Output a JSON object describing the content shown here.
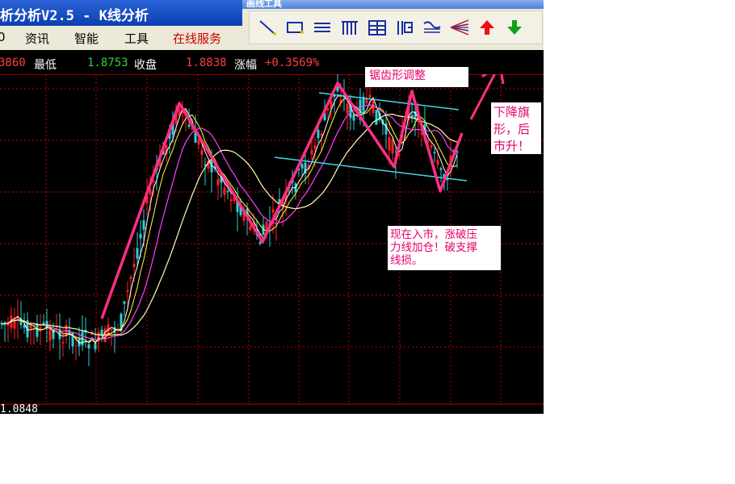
{
  "window": {
    "title": "析分析V2.5 - K线分析"
  },
  "menu": {
    "items": [
      {
        "label": "0",
        "color": "#000000"
      },
      {
        "label": "资讯",
        "color": "#000000"
      },
      {
        "label": "智能",
        "color": "#000000"
      },
      {
        "label": "工具",
        "color": "#000000"
      },
      {
        "label": "在线服务",
        "color": "#cc0000"
      }
    ]
  },
  "draw_toolbar": {
    "title": "画线工具",
    "tools": [
      {
        "icon": "diagonal-line-icon"
      },
      {
        "icon": "rectangle-icon"
      },
      {
        "icon": "parallel-lines-icon"
      },
      {
        "icon": "gann-bars-icon"
      },
      {
        "icon": "fibonacci-box-icon"
      },
      {
        "icon": "cycle-lines-icon"
      },
      {
        "icon": "percent-lines-icon"
      },
      {
        "icon": "fan-lines-icon"
      },
      {
        "icon": "up-arrow-icon"
      },
      {
        "icon": "down-arrow-icon"
      }
    ]
  },
  "quote": {
    "prefix_value": "3860",
    "low_label": "最低",
    "low_value": "1.8753",
    "close_label": "收盘",
    "close_value": "1.8838",
    "change_label": "涨幅",
    "change_value": "+0.3569%",
    "colors": {
      "label": "#ffffff",
      "green": "#2bd13d",
      "red": "#ff3d3d"
    }
  },
  "annotations": {
    "top": "锯齿形调整",
    "right_lines": [
      "下降旗",
      "形，后",
      "市升！"
    ],
    "middle_lines": [
      "现在入市，涨破压",
      "力线加仓！破支撑",
      "线损。"
    ]
  },
  "bottom_value": "1.0848",
  "chart_colors": {
    "grid": "#c80000",
    "up": "#ff2020",
    "down": "#2bd0d8",
    "ma_short": "#ffffff",
    "ma_mid": "#ffff40",
    "ma_long": "#ff40ff",
    "ma_slow": "#ffffb0",
    "pattern": "#ff2e86",
    "channel": "#40d8e8"
  }
}
